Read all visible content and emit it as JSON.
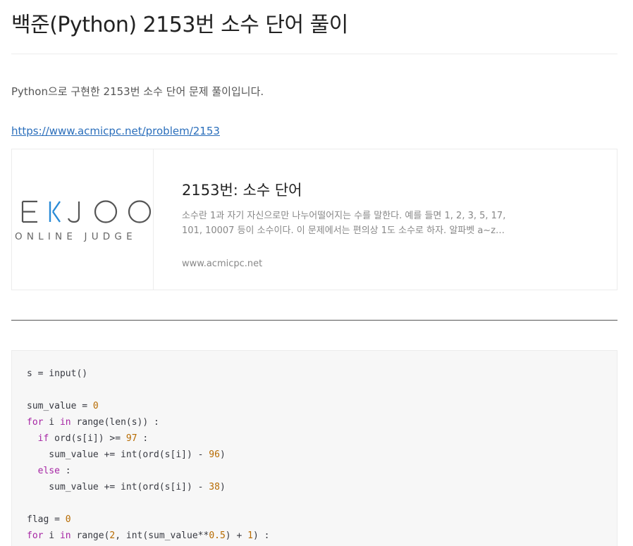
{
  "post": {
    "title": "백준(Python) 2153번 소수 단어 풀이",
    "intro": "Python으로 구현한 2153번 소수 단어 문제 풀이입니다.",
    "link": "https://www.acmicpc.net/problem/2153"
  },
  "og_card": {
    "logo_top": "EKJOO",
    "logo_bottom": "ONLINE JUDGE",
    "title": "2153번: 소수 단어",
    "description": "소수란 1과 자기 자신으로만 나누어떨어지는 수를 말한다. 예를 들면 1, 2, 3, 5, 17, 101, 10007 등이 소수이다. 이 문제에서는 편의상 1도 소수로 하자. 알파벳 a~z, A~Z로 구성된 단어가 있을 때",
    "host": "www.acmicpc.net",
    "colors": {
      "logo_accent": "#2a8bd6",
      "logo_text": "#555555"
    }
  },
  "code": {
    "language": "python",
    "lines": [
      [
        {
          "t": "s = input()"
        }
      ],
      [],
      [
        {
          "t": "sum_value = "
        },
        {
          "t": "0",
          "c": "num"
        }
      ],
      [
        {
          "t": "for",
          "c": "kw"
        },
        {
          "t": " i "
        },
        {
          "t": "in",
          "c": "kw"
        },
        {
          "t": " range(len(s)) :"
        }
      ],
      [
        {
          "t": "  "
        },
        {
          "t": "if",
          "c": "kw"
        },
        {
          "t": " ord(s[i]) >= "
        },
        {
          "t": "97",
          "c": "num"
        },
        {
          "t": " :"
        }
      ],
      [
        {
          "t": "    sum_value += int(ord(s[i]) - "
        },
        {
          "t": "96",
          "c": "num"
        },
        {
          "t": ")"
        }
      ],
      [
        {
          "t": "  "
        },
        {
          "t": "else",
          "c": "kw"
        },
        {
          "t": " :"
        }
      ],
      [
        {
          "t": "    sum_value += int(ord(s[i]) - "
        },
        {
          "t": "38",
          "c": "num"
        },
        {
          "t": ")"
        }
      ],
      [],
      [
        {
          "t": "flag = "
        },
        {
          "t": "0",
          "c": "num"
        }
      ],
      [
        {
          "t": "for",
          "c": "kw"
        },
        {
          "t": " i "
        },
        {
          "t": "in",
          "c": "kw"
        },
        {
          "t": " range("
        },
        {
          "t": "2",
          "c": "num"
        },
        {
          "t": ", int(sum_value**"
        },
        {
          "t": "0.5",
          "c": "num"
        },
        {
          "t": ") + "
        },
        {
          "t": "1",
          "c": "num"
        },
        {
          "t": ") :"
        }
      ]
    ]
  }
}
